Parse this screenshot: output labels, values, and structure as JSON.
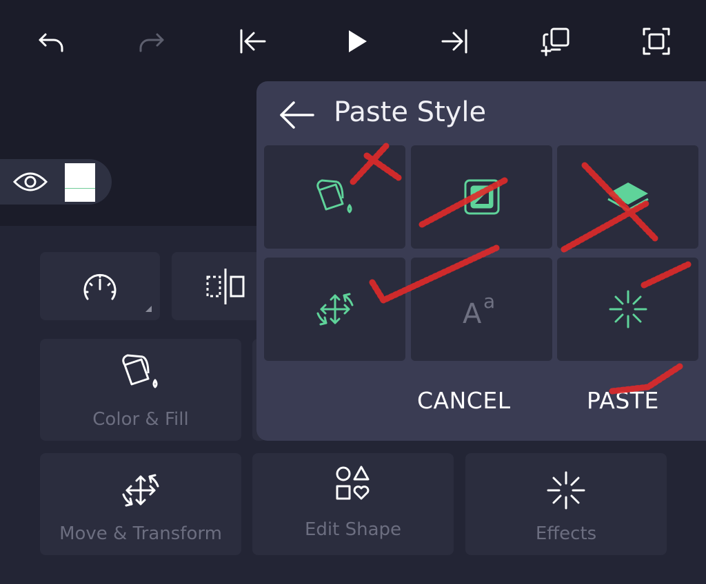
{
  "toolbar": {
    "undo_icon": "undo-icon",
    "redo_icon": "redo-icon",
    "skip_start_icon": "skip-to-start-icon",
    "play_icon": "play-icon",
    "skip_end_icon": "skip-to-end-icon",
    "duplicate_icon": "duplicate-icon",
    "fullscreen_icon": "fullscreen-icon"
  },
  "layer": {
    "visibility_icon": "eye-icon"
  },
  "tools": {
    "color_fill": "Color & Fill",
    "move_transform": "Move & Transform",
    "edit_shape": "Edit Shape",
    "effects": "Effects"
  },
  "paste_style": {
    "title": "Paste Style",
    "options": [
      "color-fill",
      "stroke",
      "layers",
      "transform",
      "text",
      "effects"
    ],
    "cancel_label": "CANCEL",
    "paste_label": "PASTE"
  },
  "colors": {
    "accent": "#5fd39a",
    "panel": "#3a3c53",
    "background": "#1b1c29",
    "annotation": "#e02a2a"
  }
}
